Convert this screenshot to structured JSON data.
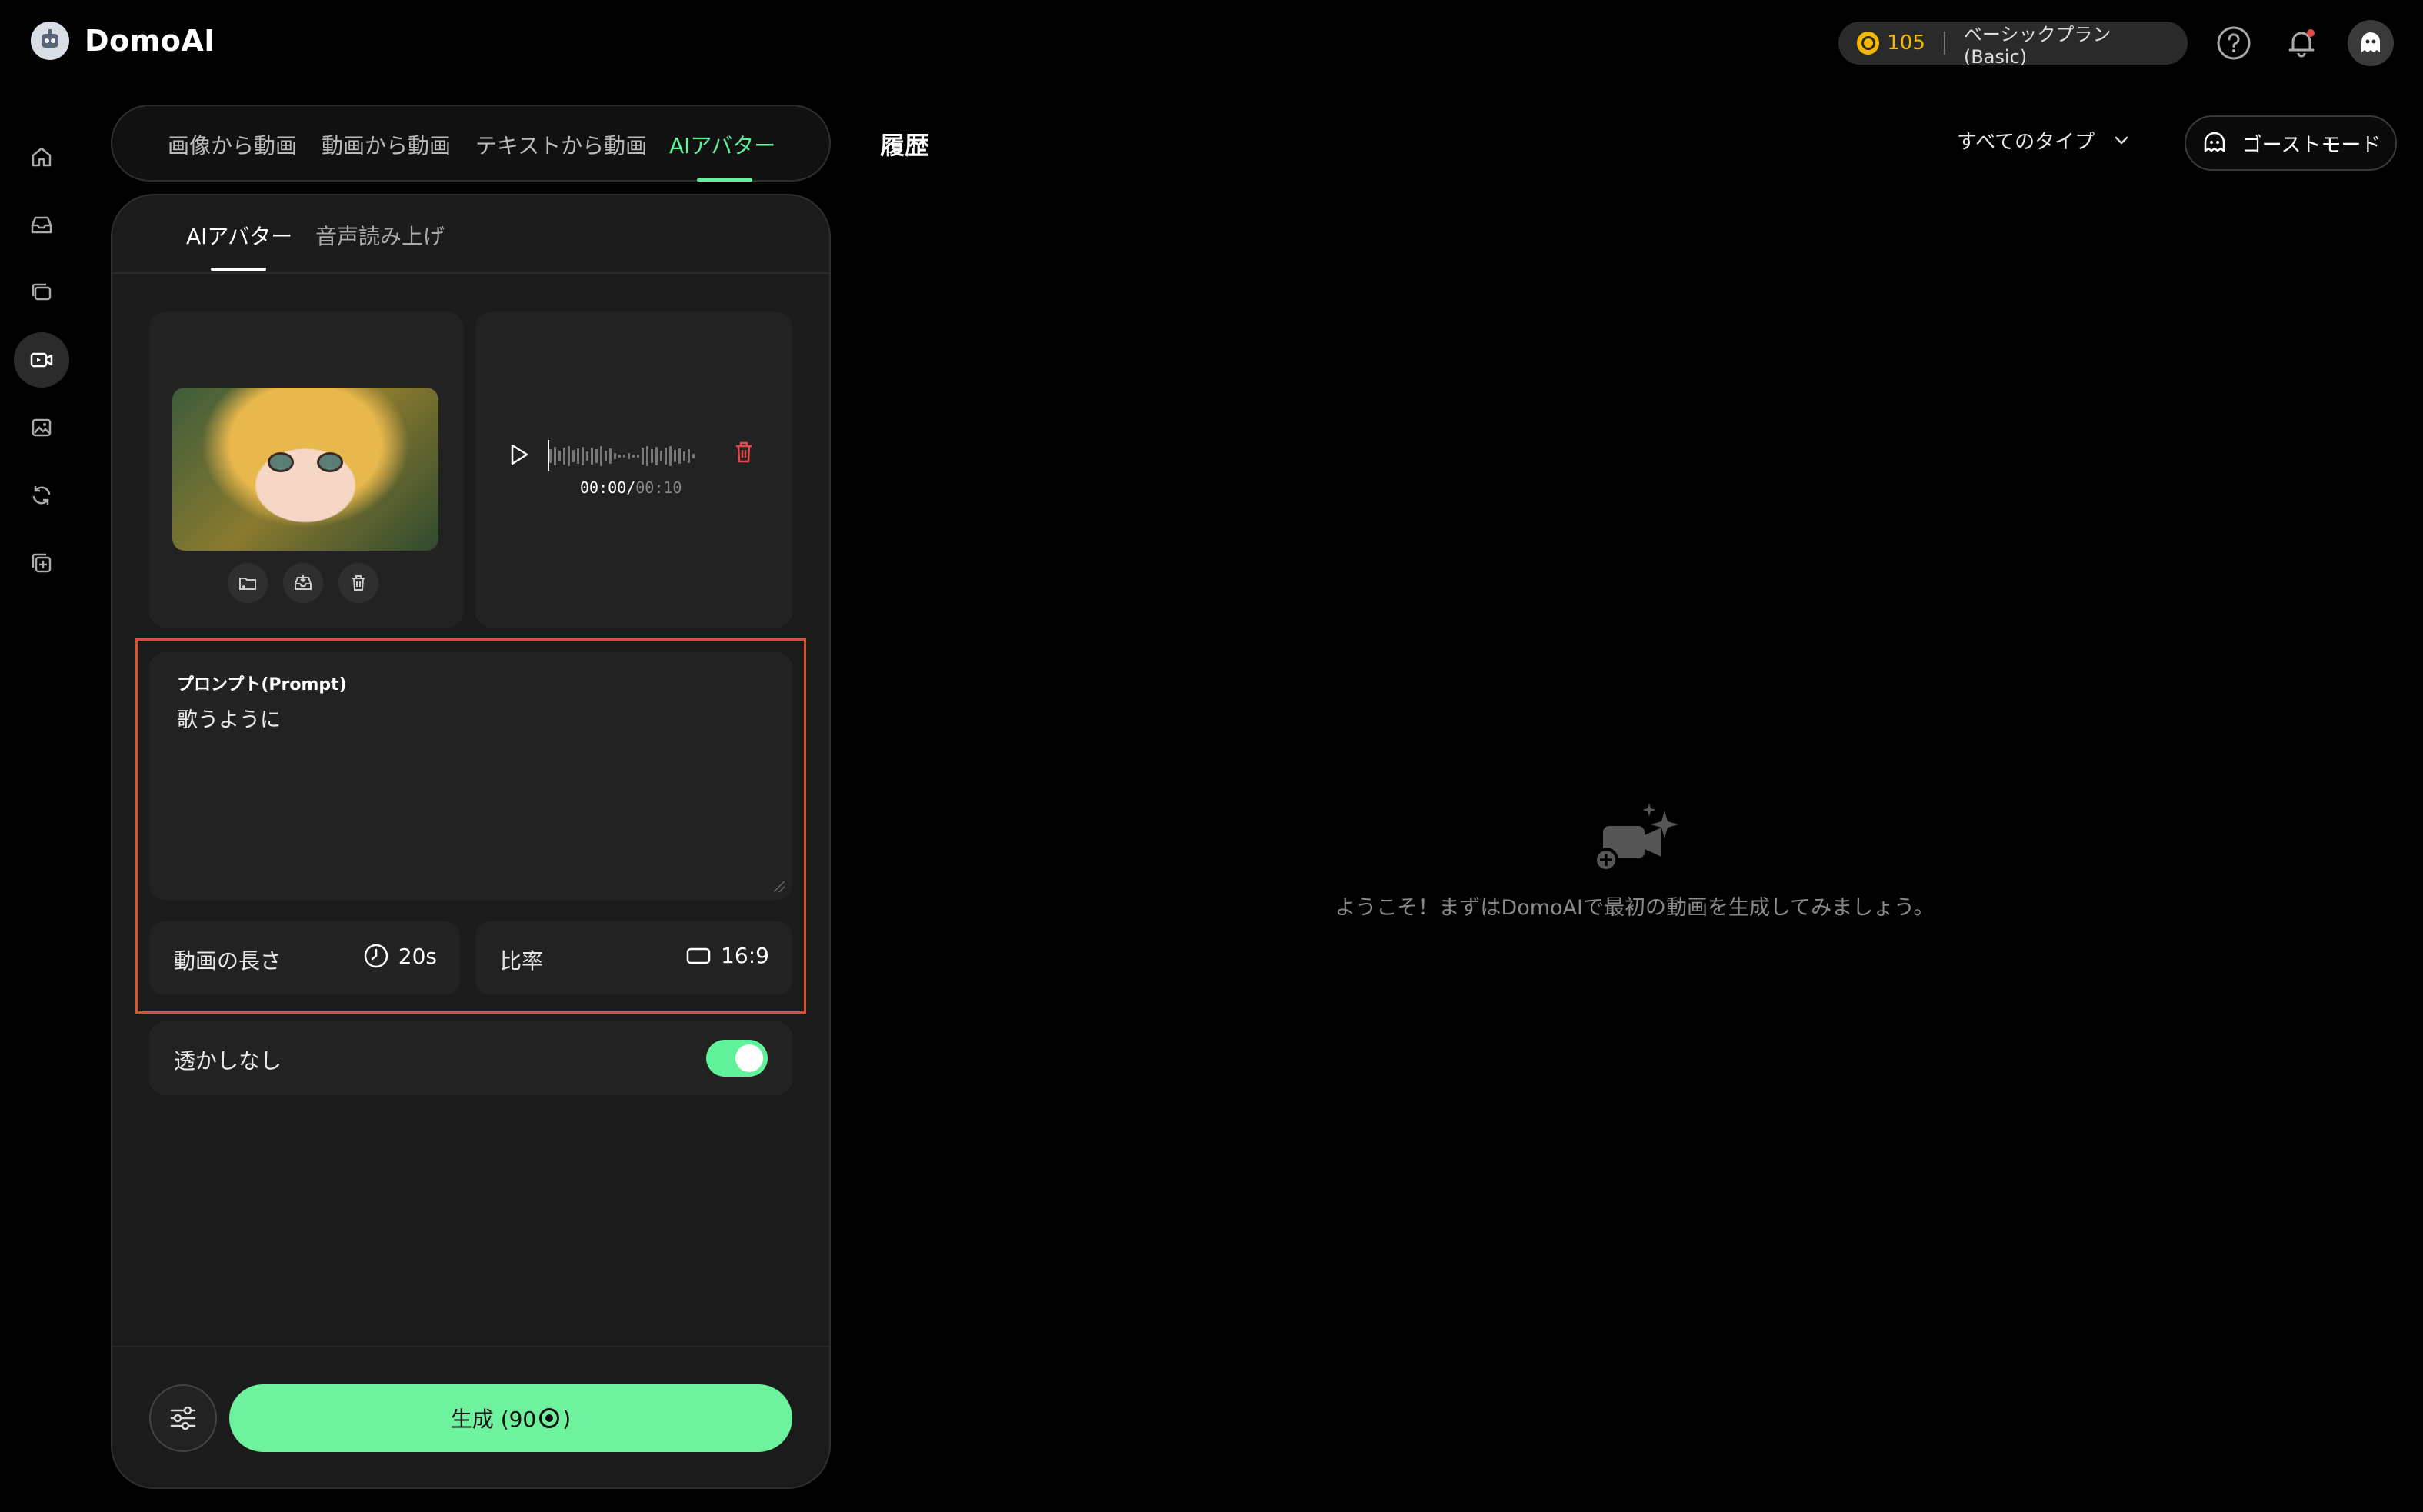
{
  "app": {
    "title": "DomoAI"
  },
  "header": {
    "credits": "105",
    "plan": "ベーシックプラン(Basic)"
  },
  "mode_tabs": [
    "画像から動画",
    "動画から動画",
    "テキストから動画",
    "AIアバター"
  ],
  "sub_tabs": [
    "AIアバター",
    "音声読み上げ"
  ],
  "audio": {
    "current": "00:00",
    "separator": "/",
    "total": "00:10"
  },
  "prompt": {
    "label": "プロンプト(Prompt)",
    "value": "歌うように"
  },
  "options": {
    "duration_label": "動画の長さ",
    "duration_value": "20s",
    "ratio_label": "比率",
    "ratio_value": "16:9"
  },
  "watermark": {
    "label": "透かしなし",
    "enabled": true
  },
  "generate": {
    "label_prefix": "生成 (90",
    "label_suffix": ")"
  },
  "history": {
    "title": "履歴",
    "filter": "すべてのタイプ",
    "ghost_mode": "ゴーストモード",
    "empty_message": "ようこそ！まずはDomoAIで最初の動画を生成してみましょう。"
  },
  "colors": {
    "accent": "#5ff29a",
    "coin": "#f5b800",
    "highlight": "#e0502f"
  }
}
